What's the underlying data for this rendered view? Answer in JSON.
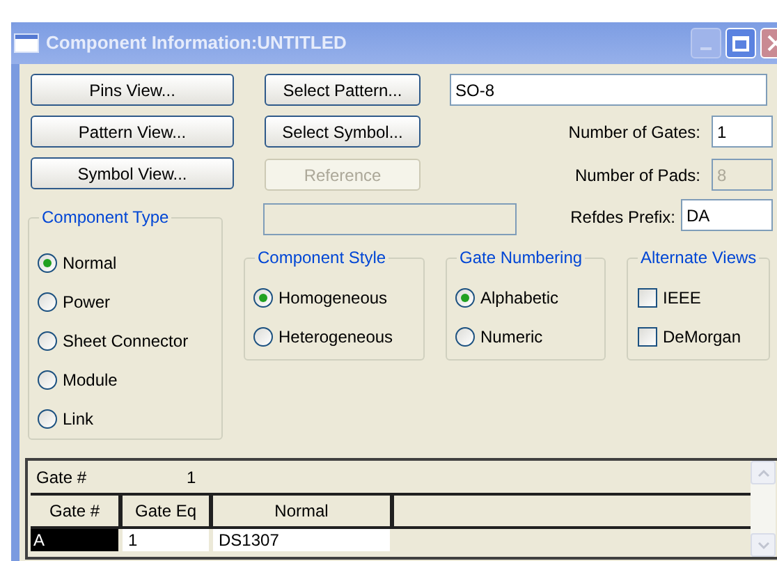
{
  "window": {
    "title": "Component Information:UNTITLED"
  },
  "view_buttons": [
    {
      "label": "Pins View..."
    },
    {
      "label": "Pattern View..."
    },
    {
      "label": "Symbol View..."
    }
  ],
  "select_buttons": [
    {
      "label": "Select Pattern...",
      "disabled": false
    },
    {
      "label": "Select Symbol...",
      "disabled": false
    },
    {
      "label": "Reference",
      "disabled": true
    }
  ],
  "pattern_field": {
    "value": "SO-8"
  },
  "number_of_gates": {
    "label": "Number of Gates:",
    "value": "1",
    "disabled": false
  },
  "number_of_pads": {
    "label": "Number of Pads:",
    "value": "8",
    "disabled": true
  },
  "reference_field": {
    "disabled": true
  },
  "refdes_prefix": {
    "label": "Refdes Prefix:",
    "value": "DA"
  },
  "component_type": {
    "title": "Component Type",
    "options": [
      {
        "label": "Normal",
        "selected": true
      },
      {
        "label": "Power",
        "selected": false
      },
      {
        "label": "Sheet Connector",
        "selected": false
      },
      {
        "label": "Module",
        "selected": false
      },
      {
        "label": "Link",
        "selected": false
      }
    ]
  },
  "component_style": {
    "title": "Component Style",
    "options": [
      {
        "label": "Homogeneous",
        "selected": true
      },
      {
        "label": "Heterogeneous",
        "selected": false
      }
    ]
  },
  "gate_numbering": {
    "title": "Gate Numbering",
    "options": [
      {
        "label": "Alphabetic",
        "selected": true
      },
      {
        "label": "Numeric",
        "selected": false
      }
    ]
  },
  "alternate_views": {
    "title": "Alternate Views",
    "options": [
      {
        "label": "IEEE",
        "checked": false
      },
      {
        "label": "DeMorgan",
        "checked": false
      }
    ]
  },
  "grid": {
    "gate_label": "Gate #",
    "gate_value": "1",
    "columns": [
      "Gate #",
      "Gate Eq",
      "Normal"
    ],
    "rows": [
      {
        "cells": [
          "A",
          "1",
          "DS1307"
        ],
        "selected": true
      }
    ]
  }
}
